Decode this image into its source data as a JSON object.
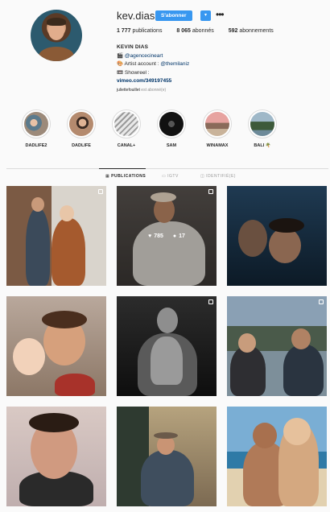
{
  "profile": {
    "username": "kev.dias",
    "follow_label": "S'abonner",
    "follow_dropdown": "▾",
    "more": "•••",
    "posts_count": "1 777",
    "posts_label": "publications",
    "followers_count": "8 065",
    "followers_label": "abonnés",
    "following_count": "592",
    "following_label": "abonnements"
  },
  "bio": {
    "name": "KEVIN DIAS",
    "line1_icon": "🎬",
    "line1_link": "@agencecineart",
    "line2_icon": "🎨",
    "line2_text": "Artist account : ",
    "line2_link": "@themilaniz",
    "line3_icon": "📼",
    "line3_text": "Showreel :",
    "external_link": "vimeo.com/349197455"
  },
  "followed_by": {
    "user": "juliettefouillet",
    "text": " est abonné(e)"
  },
  "stories": [
    {
      "label": "DADLIFE2",
      "color": "#9c8a7a"
    },
    {
      "label": "DADLIFE",
      "color": "#b48a6e"
    },
    {
      "label": "CANAL+",
      "color": "#cfcfcf"
    },
    {
      "label": "SAM",
      "color": "#111111"
    },
    {
      "label": "WINAMAX",
      "color": "#c98a8a"
    },
    {
      "label": "BALI 🌴",
      "color": "#6d8a99"
    }
  ],
  "tabs": [
    {
      "label": "PUBLICATIONS",
      "icon": "grid-icon"
    },
    {
      "label": "IGTV",
      "icon": "tv-icon"
    },
    {
      "label": "IDENTIFIÉ(E)",
      "icon": "tag-icon"
    }
  ],
  "hover_post": {
    "likes": "785",
    "comments": "17"
  },
  "colors": {
    "accent": "#3897f0",
    "link": "#003569",
    "text": "#262626",
    "muted": "#8e8e8e",
    "background": "#fafafa"
  }
}
